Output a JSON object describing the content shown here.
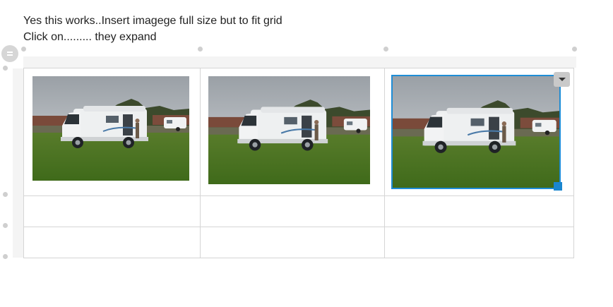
{
  "paragraphs": {
    "line1": "Yes this works..Insert imagege full size but to fit grid",
    "line2": "Click on......... they expand"
  },
  "icons": {
    "table_move": "drag-handle-icon",
    "dropdown": "chevron-down-icon",
    "resize": "resize-handle-icon"
  },
  "grid": {
    "rows": 3,
    "columns": 3,
    "images": [
      {
        "alt": "Motorhome parked on grass"
      },
      {
        "alt": "Motorhome parked on grass"
      },
      {
        "alt": "Motorhome parked on grass"
      }
    ],
    "selected_image_index": 2
  },
  "colors": {
    "selection": "#1f8dd6",
    "grid_border": "#d5d5d5",
    "ui_gray": "#cfcfcf"
  }
}
